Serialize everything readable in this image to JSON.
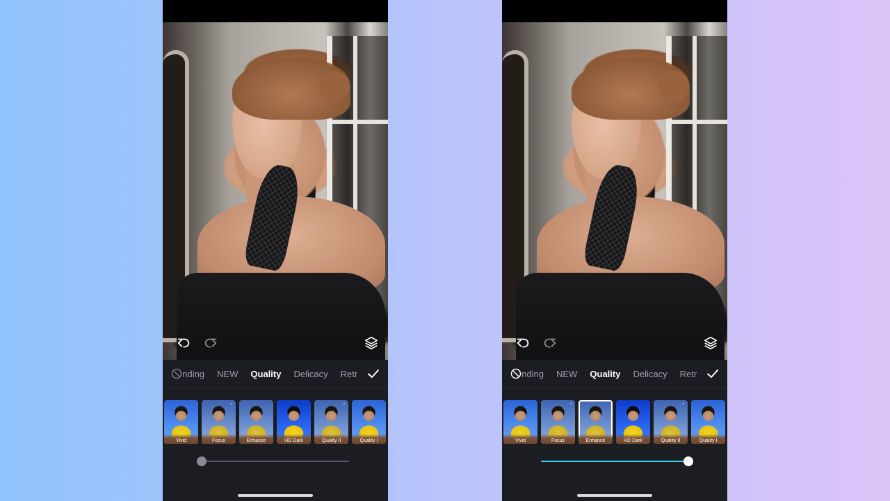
{
  "colors": {
    "accent": "#3fd2e8",
    "panel": "#1c1d22",
    "inactive_text": "#9ea0a8",
    "active_text": "#ffffff"
  },
  "icons": {
    "undo": "undo-icon",
    "redo": "redo-icon",
    "layers": "layers-icon",
    "none": "no-filter-icon",
    "confirm": "check-icon",
    "download": "download-icon"
  },
  "left": {
    "categories": [
      "ending",
      "NEW",
      "Quality",
      "Delicacy",
      "Retr"
    ],
    "active_category": "Quality",
    "filters": [
      {
        "label": "Vivid",
        "download": false,
        "selected": false
      },
      {
        "label": "Focus",
        "download": true,
        "selected": false
      },
      {
        "label": "Enhance",
        "download": false,
        "selected": false
      },
      {
        "label": "HD Dark",
        "download": false,
        "selected": false
      },
      {
        "label": "Quality II",
        "download": true,
        "selected": false
      },
      {
        "label": "Quality I",
        "download": false,
        "selected": false
      }
    ],
    "intensity": 0
  },
  "right": {
    "categories": [
      "ending",
      "NEW",
      "Quality",
      "Delicacy",
      "Retr"
    ],
    "active_category": "Quality",
    "filters": [
      {
        "label": "Vivid",
        "download": false,
        "selected": false
      },
      {
        "label": "Focus",
        "download": true,
        "selected": false
      },
      {
        "label": "Enhance",
        "download": false,
        "selected": true
      },
      {
        "label": "HD Dark",
        "download": false,
        "selected": false
      },
      {
        "label": "Quality II",
        "download": true,
        "selected": false
      },
      {
        "label": "Quality I",
        "download": false,
        "selected": false
      }
    ],
    "intensity": 1
  }
}
